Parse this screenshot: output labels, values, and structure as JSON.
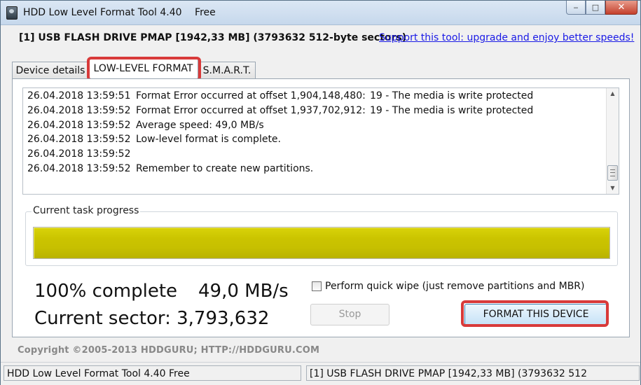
{
  "window": {
    "title": "HDD Low Level Format Tool 4.40",
    "edition": "Free",
    "controls": {
      "minimize": "‒",
      "maximize": "□",
      "close": "✕"
    }
  },
  "device": {
    "info": "[1]  USB FLASH DRIVE    PMAP    [1942,33 MB]    (3793632 512-byte sectors)"
  },
  "support_link": "Support this tool: upgrade and enjoy better speeds!",
  "tabs": [
    {
      "label": "Device details",
      "active": false
    },
    {
      "label": "LOW-LEVEL FORMAT",
      "active": true
    },
    {
      "label": "S.M.A.R.T.",
      "active": false
    }
  ],
  "log": [
    {
      "timestamp": "26.04.2018 13:59:51",
      "message": "Format Error occurred at offset 1,904,148,480:",
      "detail": "19 - The media is write protected"
    },
    {
      "timestamp": "26.04.2018 13:59:52",
      "message": "Format Error occurred at offset 1,937,702,912:",
      "detail": "19 - The media is write protected"
    },
    {
      "timestamp": "26.04.2018 13:59:52",
      "message": "Average speed: 49,0 MB/s",
      "detail": ""
    },
    {
      "timestamp": "26.04.2018 13:59:52",
      "message": "Low-level format is complete.",
      "detail": ""
    },
    {
      "timestamp": "26.04.2018 13:59:52",
      "message": "",
      "detail": ""
    },
    {
      "timestamp": "26.04.2018 13:59:52",
      "message": "Remember to create new partitions.",
      "detail": ""
    }
  ],
  "progress": {
    "label": "Current task progress",
    "fraction": 1.0,
    "fill_color": "#cbc400",
    "percent_text": "100% complete",
    "speed_text": "49,0 MB/s",
    "sector_text": "Current sector: 3,793,632"
  },
  "options": {
    "quick_wipe_label": "Perform quick wipe (just remove partitions and MBR)",
    "quick_wipe_checked": false
  },
  "buttons": {
    "stop_label": "Stop",
    "format_label": "FORMAT THIS DEVICE"
  },
  "copyright": "Copyright ©2005-2013 HDDGURU;   HTTP://HDDGURU.COM",
  "statusbar": {
    "left": "HDD Low Level Format Tool 4.40     Free",
    "right": "[1]   USB FLASH DRIVE     PMAP     [1942,33 MB]     (3793632 512"
  },
  "colors": {
    "highlight": "#d83a3a",
    "link": "#1a1ae6"
  },
  "icons": {
    "app": "hdd-icon",
    "scroll_up": "▲",
    "scroll_down": "▼"
  }
}
